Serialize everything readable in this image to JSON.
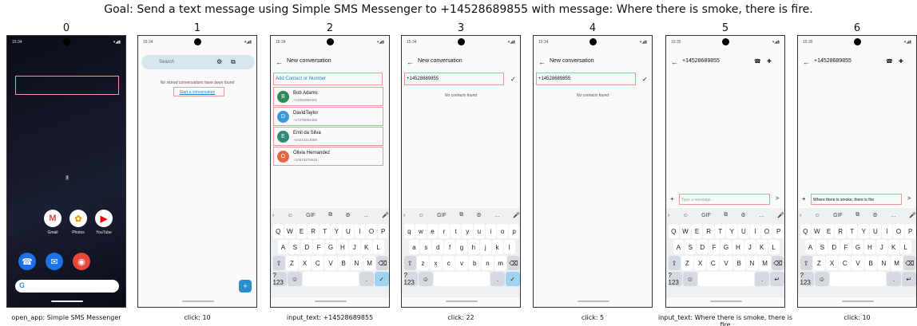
{
  "goal": "Goal: Send a text message using Simple SMS Messenger to +14528689855 with message: Where there is smoke, there is fire.",
  "steps": [
    {
      "num": "0",
      "caption": "open_app: Simple SMS Messenger"
    },
    {
      "num": "1",
      "caption": "click: 10"
    },
    {
      "num": "2",
      "caption": "input_text: +14528689855"
    },
    {
      "num": "3",
      "caption": "click: 22"
    },
    {
      "num": "4",
      "caption": "click: 5"
    },
    {
      "num": "5",
      "caption": "input_text: Where there is smoke, there is fire"
    },
    {
      "num": "6",
      "caption": "click: 10"
    }
  ],
  "status": {
    "time_a": "15:34",
    "time_b": "15:35"
  },
  "home": {
    "apps": [
      {
        "label": "Gmail",
        "glyph": "M"
      },
      {
        "label": "Photos",
        "glyph": "✿"
      },
      {
        "label": "YouTube",
        "glyph": "▶"
      }
    ],
    "dock": [
      {
        "glyph": "☎"
      },
      {
        "glyph": "✉"
      },
      {
        "glyph": "◉"
      }
    ],
    "search_glyph": "G",
    "mid_tag": "3"
  },
  "screen1": {
    "search_placeholder": "Search",
    "empty_text": "No stored conversations have been found",
    "start_link": "Start a conversation",
    "fab_glyph": "+"
  },
  "screen2": {
    "title": "New conversation",
    "input_placeholder": "Add Contact or Number",
    "contacts": [
      {
        "initial": "B",
        "name": "Bob Adams",
        "phone": "+12082984491",
        "color": "#2e8b57"
      },
      {
        "initial": "D",
        "name": "DavidTaylor",
        "phone": "+17276084450",
        "color": "#3a9ad9"
      },
      {
        "initial": "E",
        "name": "Emil da Silva",
        "phone": "+10213113008",
        "color": "#2f8a7a"
      },
      {
        "initial": "O",
        "name": "Olivia Hernandez",
        "phone": "+10573276615",
        "color": "#e8663d"
      }
    ]
  },
  "screen3": {
    "title": "New conversation",
    "number": "+14528689855",
    "no_contacts": "No contacts found"
  },
  "screen5": {
    "number": "+14528689855",
    "message_placeholder": "Type a message...",
    "typed_message": "Where there is smoke, there is fire"
  },
  "keyboard": {
    "row1": [
      "Q",
      "W",
      "E",
      "R",
      "T",
      "Y",
      "U",
      "I",
      "O",
      "P"
    ],
    "row2": [
      "A",
      "S",
      "D",
      "F",
      "G",
      "H",
      "J",
      "K",
      "L"
    ],
    "row3": [
      "Z",
      "X",
      "C",
      "V",
      "B",
      "N",
      "M"
    ],
    "sym": "?123",
    "row1_lower": [
      "q",
      "w",
      "e",
      "r",
      "t",
      "y",
      "u",
      "i",
      "o",
      "p"
    ],
    "row2_lower": [
      "a",
      "s",
      "d",
      "f",
      "g",
      "h",
      "j",
      "k",
      "l"
    ],
    "row3_lower": [
      "z",
      "x",
      "c",
      "v",
      "b",
      "n",
      "m"
    ]
  }
}
